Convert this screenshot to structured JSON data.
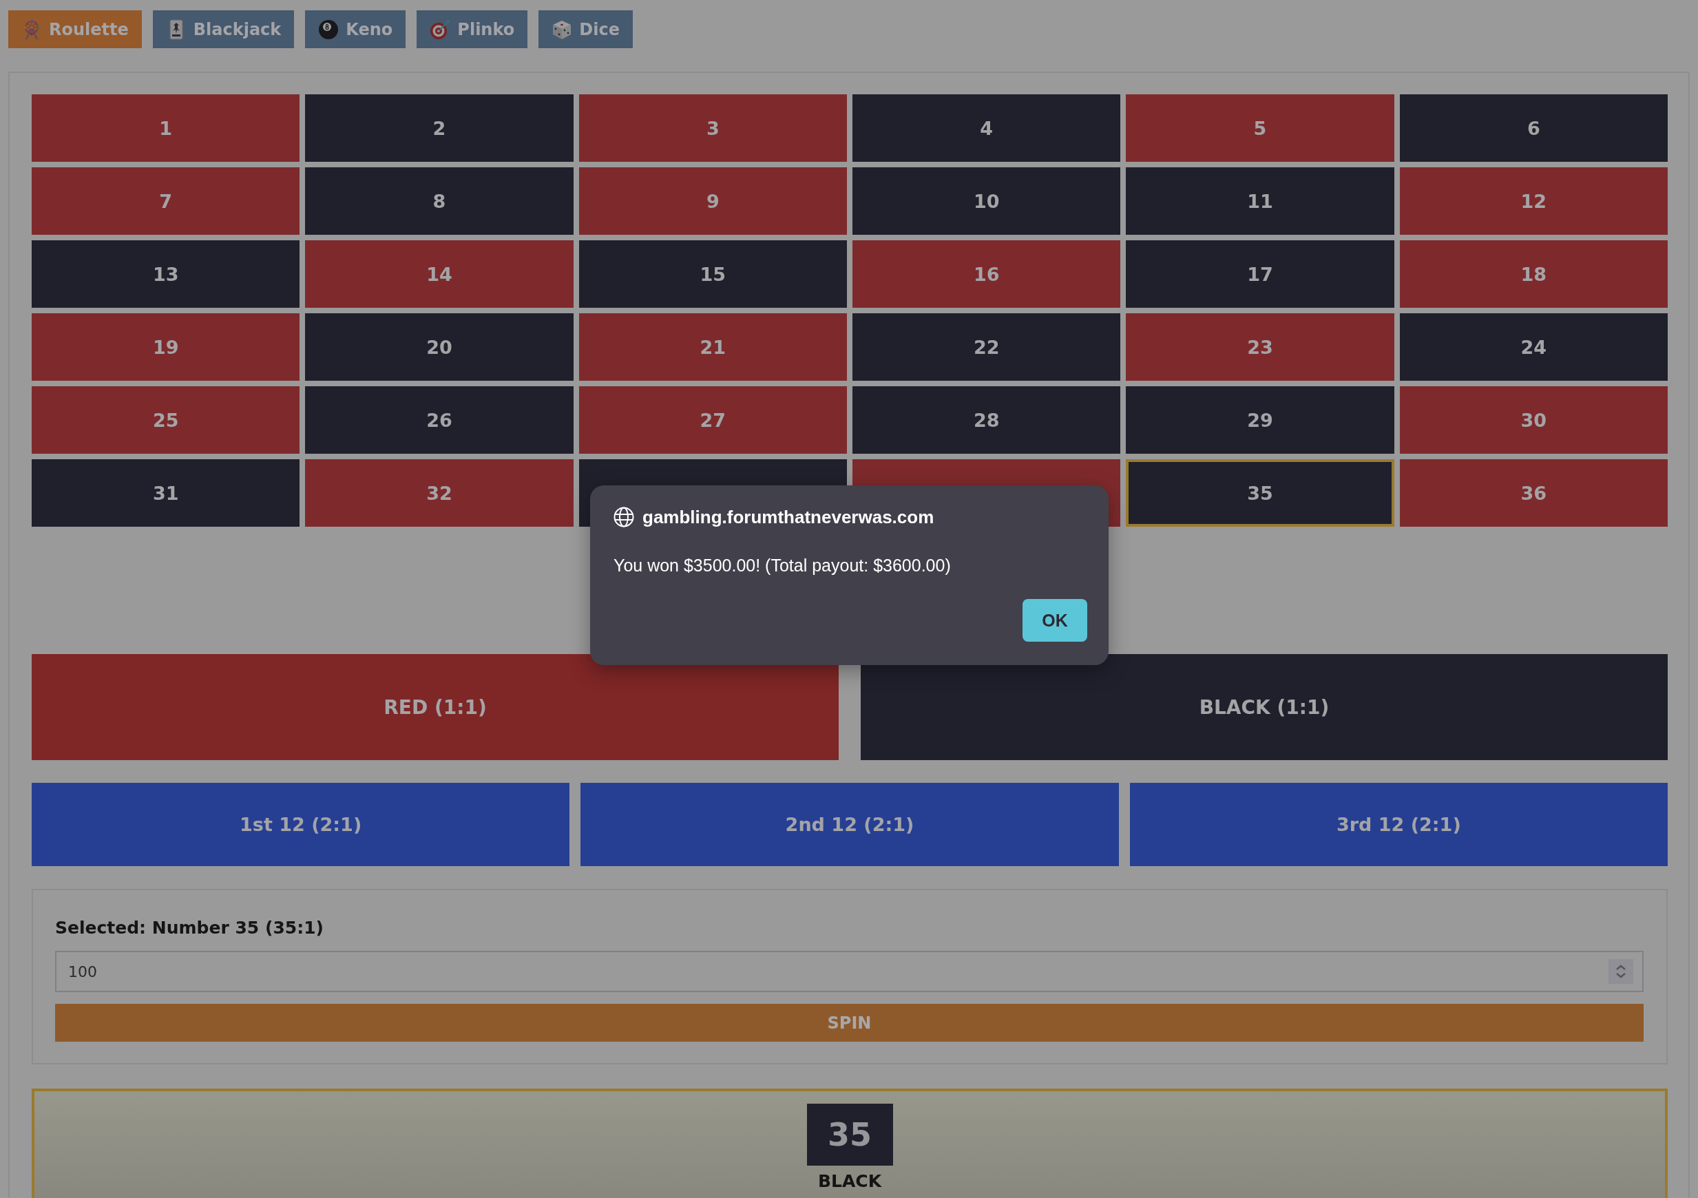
{
  "tabs": [
    {
      "label": "Roulette",
      "selected": true
    },
    {
      "label": "Blackjack",
      "selected": false
    },
    {
      "label": "Keno",
      "selected": false
    },
    {
      "label": "Plinko",
      "selected": false
    },
    {
      "label": "Dice",
      "selected": false
    }
  ],
  "roulette_board": {
    "cells": [
      {
        "number": "1",
        "color": "#7e2a2c",
        "selected": false
      },
      {
        "number": "2",
        "color": "#1f202c",
        "selected": false
      },
      {
        "number": "3",
        "color": "#7e2a2c",
        "selected": false
      },
      {
        "number": "4",
        "color": "#1f202c",
        "selected": false
      },
      {
        "number": "5",
        "color": "#7e2a2c",
        "selected": false
      },
      {
        "number": "6",
        "color": "#1f202c",
        "selected": false
      },
      {
        "number": "7",
        "color": "#7e2a2c",
        "selected": false
      },
      {
        "number": "8",
        "color": "#1f202c",
        "selected": false
      },
      {
        "number": "9",
        "color": "#7e2a2c",
        "selected": false
      },
      {
        "number": "10",
        "color": "#1f202c",
        "selected": false
      },
      {
        "number": "11",
        "color": "#1f202c",
        "selected": false
      },
      {
        "number": "12",
        "color": "#7e2a2c",
        "selected": false
      },
      {
        "number": "13",
        "color": "#1f202c",
        "selected": false
      },
      {
        "number": "14",
        "color": "#7e2a2c",
        "selected": false
      },
      {
        "number": "15",
        "color": "#1f202c",
        "selected": false
      },
      {
        "number": "16",
        "color": "#7e2a2c",
        "selected": false
      },
      {
        "number": "17",
        "color": "#1f202c",
        "selected": false
      },
      {
        "number": "18",
        "color": "#7e2a2c",
        "selected": false
      },
      {
        "number": "19",
        "color": "#7e2a2c",
        "selected": false
      },
      {
        "number": "20",
        "color": "#1f202c",
        "selected": false
      },
      {
        "number": "21",
        "color": "#7e2a2c",
        "selected": false
      },
      {
        "number": "22",
        "color": "#1f202c",
        "selected": false
      },
      {
        "number": "23",
        "color": "#7e2a2c",
        "selected": false
      },
      {
        "number": "24",
        "color": "#1f202c",
        "selected": false
      },
      {
        "number": "25",
        "color": "#7e2a2c",
        "selected": false
      },
      {
        "number": "26",
        "color": "#1f202c",
        "selected": false
      },
      {
        "number": "27",
        "color": "#7e2a2c",
        "selected": false
      },
      {
        "number": "28",
        "color": "#1f202c",
        "selected": false
      },
      {
        "number": "29",
        "color": "#1f202c",
        "selected": false
      },
      {
        "number": "30",
        "color": "#7e2a2c",
        "selected": false
      },
      {
        "number": "31",
        "color": "#1f202c",
        "selected": false
      },
      {
        "number": "32",
        "color": "#7e2a2c",
        "selected": false
      },
      {
        "color": "#1f202c",
        "selected": false
      },
      {
        "color": "#7e2a2c",
        "selected": false
      },
      {
        "number": "35",
        "color": "#1f202c",
        "selected": true
      },
      {
        "number": "36",
        "color": "#7e2a2c",
        "selected": false
      }
    ]
  },
  "color_bets": [
    {
      "label": "RED (1:1)",
      "color": "#7f2626"
    },
    {
      "label": "BLACK (1:1)",
      "color": "#1f202c"
    }
  ],
  "dozen_bets": [
    {
      "label": "1st 12 (2:1)"
    },
    {
      "label": "2nd 12 (2:1)"
    },
    {
      "label": "3rd 12 (2:1)"
    }
  ],
  "bet_panel": {
    "selection": "Selected: Number 35 (35:1)",
    "amount": "100",
    "spin_button": "SPIN"
  },
  "result": {
    "number": "35",
    "color_name": "BLACK"
  },
  "dialog": {
    "origin": "gambling.forumthatneverwas.com",
    "message": "You won $3500.00! (Total payout: $3600.00)",
    "buttons": [
      "OK"
    ]
  }
}
